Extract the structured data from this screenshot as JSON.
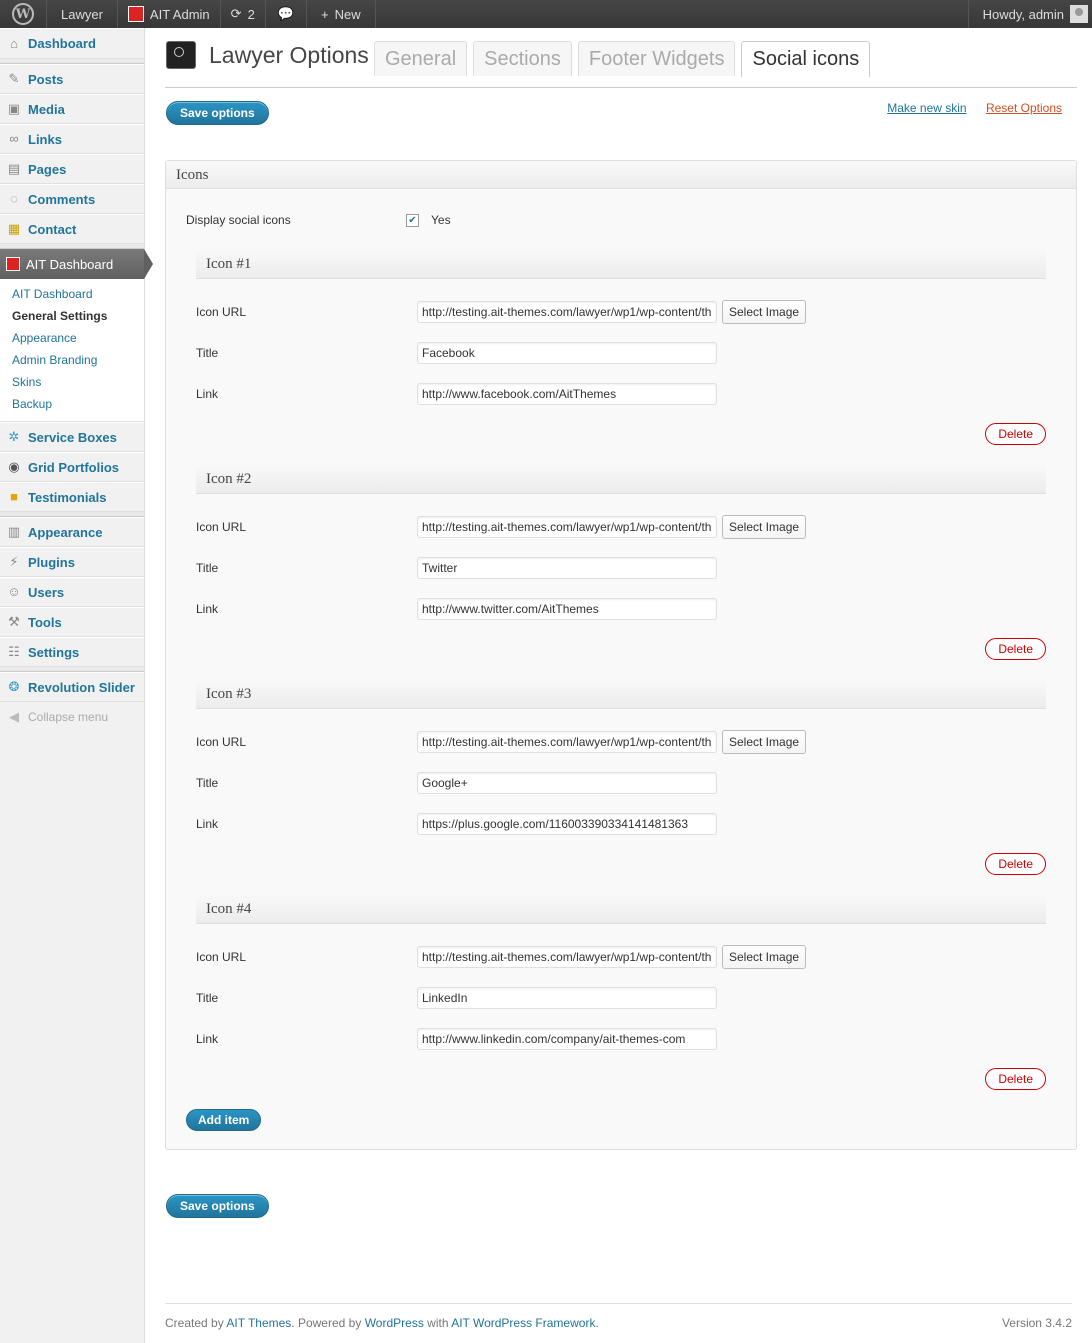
{
  "adminbar": {
    "site_name": "Lawyer",
    "ait_admin": "AIT Admin",
    "updates_count": "2",
    "new_label": "New",
    "howdy": "Howdy, admin"
  },
  "sidebar": {
    "items": [
      {
        "label": "Dashboard",
        "icon": "dashboard-icon"
      },
      {
        "label": "Posts",
        "icon": "posts-icon"
      },
      {
        "label": "Media",
        "icon": "media-icon"
      },
      {
        "label": "Links",
        "icon": "links-icon"
      },
      {
        "label": "Pages",
        "icon": "pages-icon"
      },
      {
        "label": "Comments",
        "icon": "comments-icon"
      },
      {
        "label": "Contact",
        "icon": "contact-icon"
      },
      {
        "label": "AIT Dashboard",
        "icon": "ait-icon"
      },
      {
        "label": "Service Boxes",
        "icon": "gear-icon"
      },
      {
        "label": "Grid Portfolios",
        "icon": "portfolio-icon"
      },
      {
        "label": "Testimonials",
        "icon": "box-icon"
      },
      {
        "label": "Appearance",
        "icon": "appearance-icon"
      },
      {
        "label": "Plugins",
        "icon": "plugins-icon"
      },
      {
        "label": "Users",
        "icon": "users-icon"
      },
      {
        "label": "Tools",
        "icon": "tools-icon"
      },
      {
        "label": "Settings",
        "icon": "settings-icon"
      },
      {
        "label": "Revolution Slider",
        "icon": "slider-icon"
      },
      {
        "label": "Collapse menu",
        "icon": "collapse-icon"
      }
    ],
    "submenu": [
      "AIT Dashboard",
      "General Settings",
      "Appearance",
      "Admin Branding",
      "Skins",
      "Backup"
    ]
  },
  "header": {
    "title": "Lawyer Options",
    "tabs": [
      "General",
      "Sections",
      "Footer Widgets",
      "Social icons"
    ]
  },
  "toolbar": {
    "save_label": "Save options",
    "make_skin": "Make new skin",
    "reset": "Reset Options"
  },
  "icons_box": {
    "title": "Icons",
    "display_label": "Display social icons",
    "display_value": "Yes",
    "field_labels": {
      "url": "Icon URL",
      "title": "Title",
      "link": "Link"
    },
    "select_image": "Select Image",
    "delete": "Delete",
    "add_item": "Add item",
    "items": [
      {
        "heading": "Icon #1",
        "url": "http://testing.ait-themes.com/lawyer/wp1/wp-content/th",
        "title": "Facebook",
        "link": "http://www.facebook.com/AitThemes"
      },
      {
        "heading": "Icon #2",
        "url": "http://testing.ait-themes.com/lawyer/wp1/wp-content/th",
        "title": "Twitter",
        "link": "http://www.twitter.com/AitThemes"
      },
      {
        "heading": "Icon #3",
        "url": "http://testing.ait-themes.com/lawyer/wp1/wp-content/th",
        "title": "Google+",
        "link": "https://plus.google.com/116003390334141481363"
      },
      {
        "heading": "Icon #4",
        "url": "http://testing.ait-themes.com/lawyer/wp1/wp-content/th",
        "title": "LinkedIn",
        "link": "http://www.linkedin.com/company/ait-themes-com"
      }
    ]
  },
  "footer": {
    "created_by": "Created by",
    "ait_themes": "AIT Themes",
    "powered_by": ". Powered by",
    "wordpress": "WordPress",
    "with": "with",
    "framework": "AIT WordPress Framework",
    "period": ".",
    "version": "Version 3.4.2"
  }
}
